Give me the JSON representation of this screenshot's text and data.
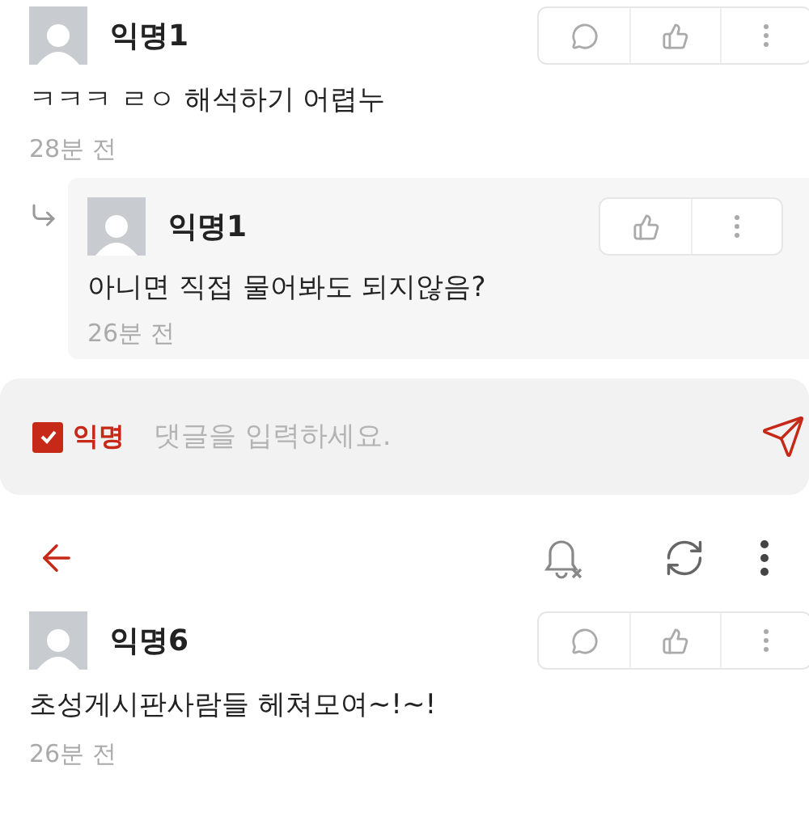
{
  "comments": [
    {
      "kind": "comment",
      "author": "익명1",
      "text": "ㅋㅋㅋ ㄹㅇ 해석하기 어렵누",
      "time": "28분 전"
    },
    {
      "kind": "reply",
      "author": "익명1",
      "text": "아니면 직접 물어봐도 되지않음?",
      "time": "26분 전"
    }
  ],
  "composer": {
    "anonymous": {
      "label": "익명",
      "checked": true
    },
    "placeholder": "댓글을 입력하세요."
  },
  "second_comments": [
    {
      "kind": "comment",
      "author": "익명6",
      "text": "초성게시판사람들 헤쳐모여~!~!",
      "time": "26분 전"
    }
  ]
}
